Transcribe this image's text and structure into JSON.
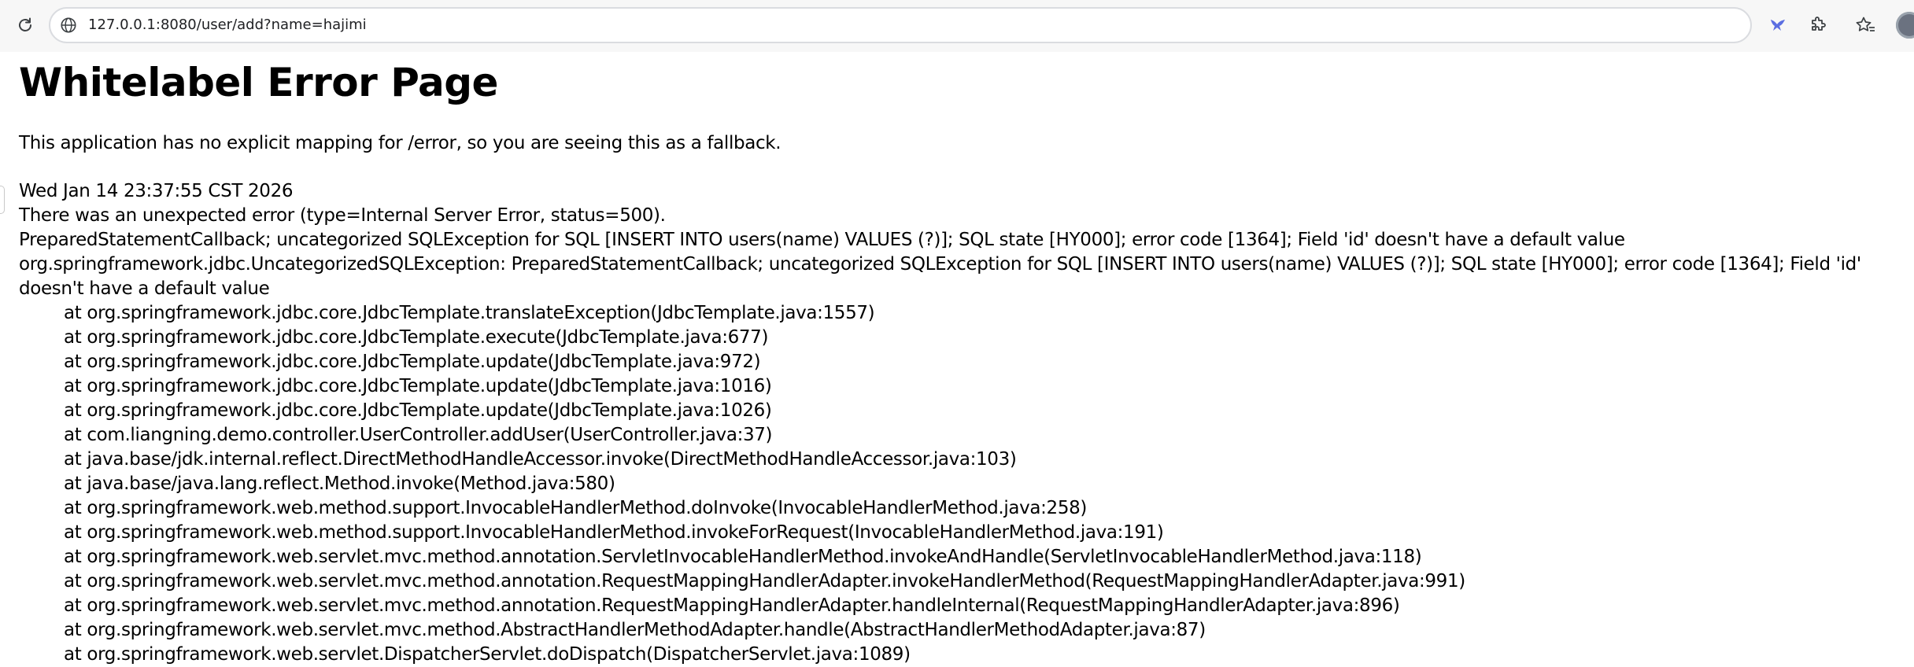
{
  "browser": {
    "url": "127.0.0.1:8080/user/add?name=hajimi"
  },
  "page": {
    "title": "Whitelabel Error Page",
    "intro": "This application has no explicit mapping for /error, so you are seeing this as a fallback.",
    "timestamp": "Wed Jan 14 23:37:55 CST 2026",
    "error_summary": "There was an unexpected error (type=Internal Server Error, status=500).",
    "message": "PreparedStatementCallback; uncategorized SQLException for SQL [INSERT INTO users(name) VALUES (?)]; SQL state [HY000]; error code [1364]; Field 'id' doesn't have a default value",
    "exception": "org.springframework.jdbc.UncategorizedSQLException: PreparedStatementCallback; uncategorized SQLException for SQL [INSERT INTO users(name) VALUES (?)]; SQL state [HY000]; error code [1364]; Field 'id' doesn't have a default value",
    "stack_trace": [
      "at org.springframework.jdbc.core.JdbcTemplate.translateException(JdbcTemplate.java:1557)",
      "at org.springframework.jdbc.core.JdbcTemplate.execute(JdbcTemplate.java:677)",
      "at org.springframework.jdbc.core.JdbcTemplate.update(JdbcTemplate.java:972)",
      "at org.springframework.jdbc.core.JdbcTemplate.update(JdbcTemplate.java:1016)",
      "at org.springframework.jdbc.core.JdbcTemplate.update(JdbcTemplate.java:1026)",
      "at com.liangning.demo.controller.UserController.addUser(UserController.java:37)",
      "at java.base/jdk.internal.reflect.DirectMethodHandleAccessor.invoke(DirectMethodHandleAccessor.java:103)",
      "at java.base/java.lang.reflect.Method.invoke(Method.java:580)",
      "at org.springframework.web.method.support.InvocableHandlerMethod.doInvoke(InvocableHandlerMethod.java:258)",
      "at org.springframework.web.method.support.InvocableHandlerMethod.invokeForRequest(InvocableHandlerMethod.java:191)",
      "at org.springframework.web.servlet.mvc.method.annotation.ServletInvocableHandlerMethod.invokeAndHandle(ServletInvocableHandlerMethod.java:118)",
      "at org.springframework.web.servlet.mvc.method.annotation.RequestMappingHandlerAdapter.invokeHandlerMethod(RequestMappingHandlerAdapter.java:991)",
      "at org.springframework.web.servlet.mvc.method.annotation.RequestMappingHandlerAdapter.handleInternal(RequestMappingHandlerAdapter.java:896)",
      "at org.springframework.web.servlet.mvc.method.AbstractHandlerMethodAdapter.handle(AbstractHandlerMethodAdapter.java:87)",
      "at org.springframework.web.servlet.DispatcherServlet.doDispatch(DispatcherServlet.java:1089)"
    ]
  },
  "icons": {
    "reload": "reload-icon",
    "site_info": "site-info-icon",
    "extension_bird": "bird-extension-icon",
    "extensions": "puzzle-icon",
    "favorites": "favorites-star-icon",
    "profile": "avatar"
  },
  "colors": {
    "toolbar_bg": "#f7f7f7",
    "omnibox_border": "#dadce0",
    "extension_accent": "#5b6ee1",
    "text": "#000000"
  }
}
